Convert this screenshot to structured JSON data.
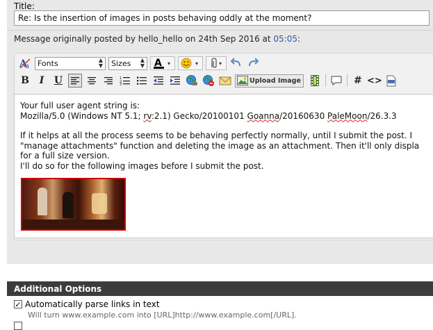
{
  "title_field": {
    "label": "Title:",
    "value": "Re: Is the insertion of images in posts behaving oddly at the moment?"
  },
  "original_post": {
    "prefix": "Message originally posted by hello_hello on 24th Sep 2016 at ",
    "time": "05:05",
    "suffix": ":"
  },
  "toolbar": {
    "fonts_label": "Fonts",
    "sizes_label": "Sizes",
    "upload_label": "Upload Image",
    "code_label": "#",
    "html_label": "<>"
  },
  "message": {
    "line1": "Your full user agent string is:",
    "line2a": "Mozilla/5.0 (Windows NT 5.1; ",
    "line2b": "rv",
    "line2c": ":2.1) Gecko/20100101 ",
    "line2d": "Goanna",
    "line2e": "/20160630 ",
    "line2f": "PaleMoon",
    "line2g": "/26.3.3",
    "line3": "If it helps at all the process seems to be behaving perfectly normally, until I submit the post. I",
    "line4": "\"manage attachments\" function and deleting the image as an attachment. Then it'll only displa",
    "line5": "for a full size version.",
    "line6": "I'll do so for the following images before I submit the post."
  },
  "additional_options": {
    "heading": "Additional Options",
    "parse_links_label": "Automatically parse links in text",
    "parse_links_desc": "Will turn www.example.com into [URL]http://www.example.com[/URL].",
    "parse_links_checked": true
  },
  "colors": {
    "time_link": "#2a5aa3",
    "options_header_bg": "#3c3c3c",
    "image_border": "#cc0000"
  }
}
